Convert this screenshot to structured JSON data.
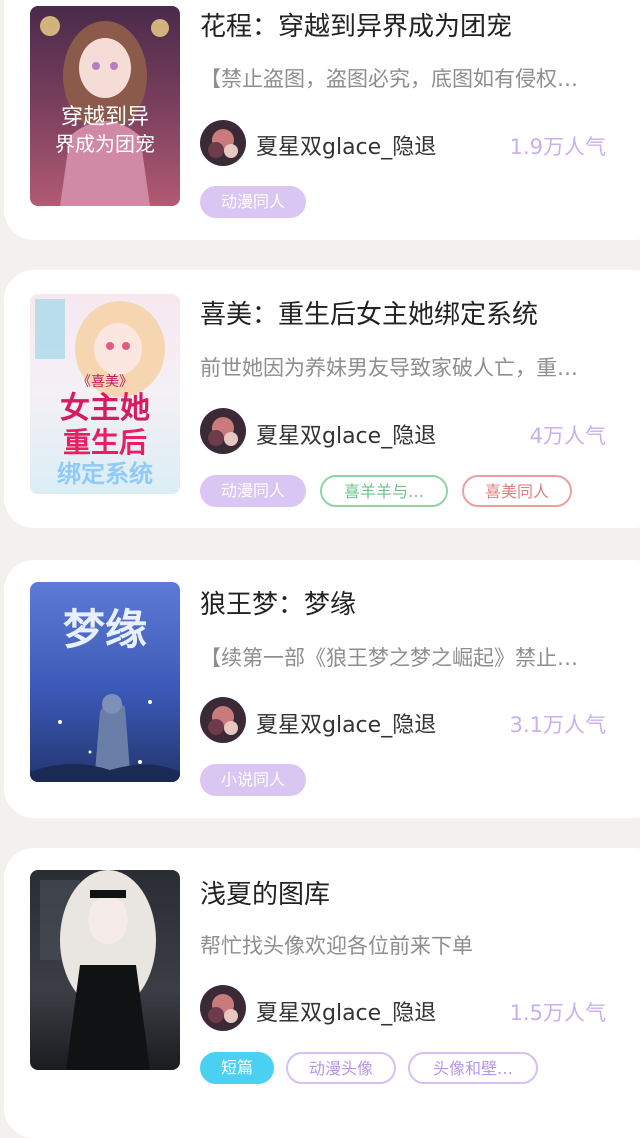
{
  "books": [
    {
      "title": "花程：穿越到异界成为团宠",
      "description": "【禁止盗图，盗图必究，底图如有侵权…",
      "author": "夏星双glace_隐退",
      "popularity": "1.9万人气",
      "cover_text": [
        "穿越到异",
        "界成为团宠"
      ],
      "tags": [
        "动漫同人"
      ]
    },
    {
      "title": "喜美：重生后女主她绑定系统",
      "description": "前世她因为养妹男友导致家破人亡，重…",
      "author": "夏星双glace_隐退",
      "popularity": "4万人气",
      "cover_text": [
        "《喜美》",
        "女主她",
        "重生后",
        "绑定系统"
      ],
      "tags": [
        "动漫同人",
        "喜羊羊与…",
        "喜美同人"
      ]
    },
    {
      "title": "狼王梦：梦缘",
      "description": "【续第一部《狼王梦之梦之崛起》禁止…",
      "author": "夏星双glace_隐退",
      "popularity": "3.1万人气",
      "cover_text": [
        "梦缘"
      ],
      "tags": [
        "小说同人"
      ]
    },
    {
      "title": "浅夏的图库",
      "description": "帮忙找头像欢迎各位前来下单",
      "author": "夏星双glace_隐退",
      "popularity": "1.5万人气",
      "cover_text": [],
      "tags": [
        "短篇",
        "动漫头像",
        "头像和壁…"
      ]
    }
  ],
  "colors": {
    "background": "#f3f1ee",
    "popularity": "#c9b0ec",
    "tag_purple": "#d9c6f3",
    "tag_blue": "#4ad0f0"
  }
}
